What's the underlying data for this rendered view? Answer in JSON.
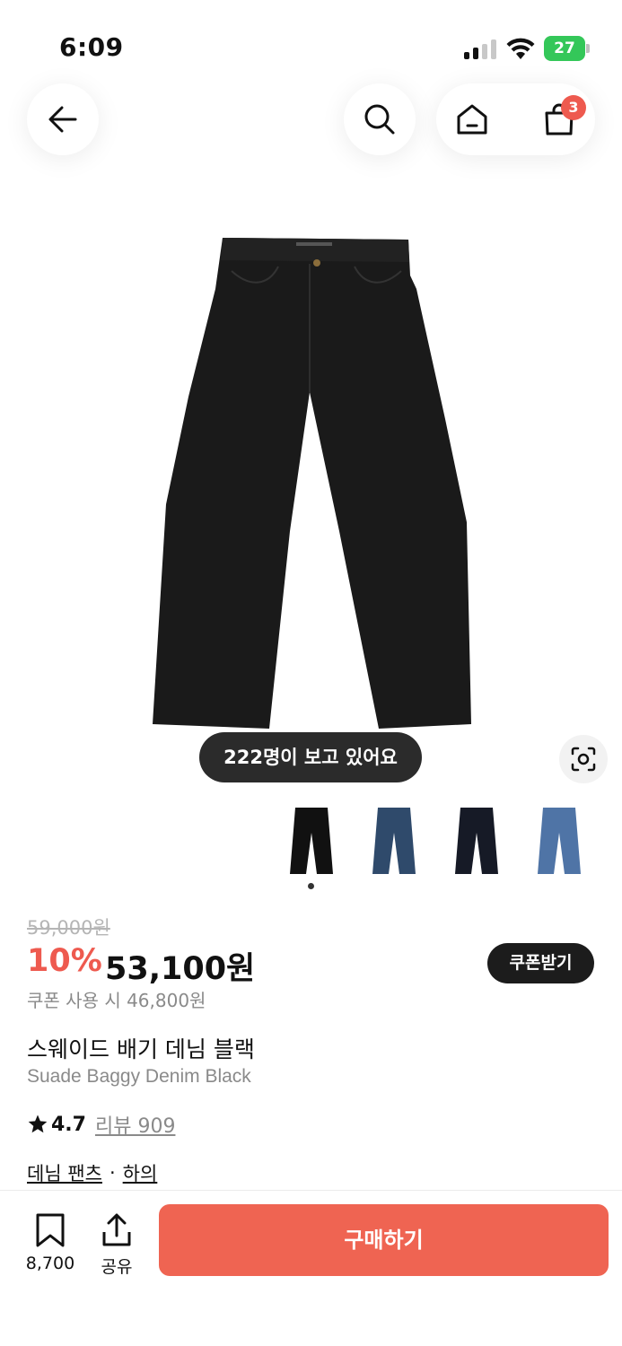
{
  "status_bar": {
    "time": "6:09",
    "battery": "27"
  },
  "nav": {
    "back_icon": "arrow-left-icon",
    "search_icon": "search-icon",
    "home_icon": "home-icon",
    "cart_icon": "shopping-bag-icon",
    "cart_count": "3"
  },
  "gallery": {
    "viewers_text": "222명이 보고 있어요",
    "lens_icon": "visual-search-icon",
    "thumbnails": [
      "black",
      "dark-blue",
      "navy-black",
      "light-blue"
    ],
    "active_index": 0
  },
  "price": {
    "original": "59,000원",
    "discount": "10%",
    "sale": "53,100원",
    "coupon_button": "쿠폰받기",
    "coupon_price": "쿠폰 사용 시 46,800원"
  },
  "product": {
    "name_ko": "스웨이드 배기 데님 블랙",
    "name_en": "Suade Baggy Denim Black",
    "rating": "4.7",
    "review_link": "리뷰 909",
    "category_1": "데님 팬츠",
    "separator": "·",
    "category_2": "하의"
  },
  "bottom_bar": {
    "save_count": "8,700",
    "share_label": "공유",
    "buy_label": "구매하기"
  },
  "colors": {
    "accent": "#ee5a4f",
    "buy_button": "#ef6452",
    "dark_pill": "#1c1c1c"
  }
}
